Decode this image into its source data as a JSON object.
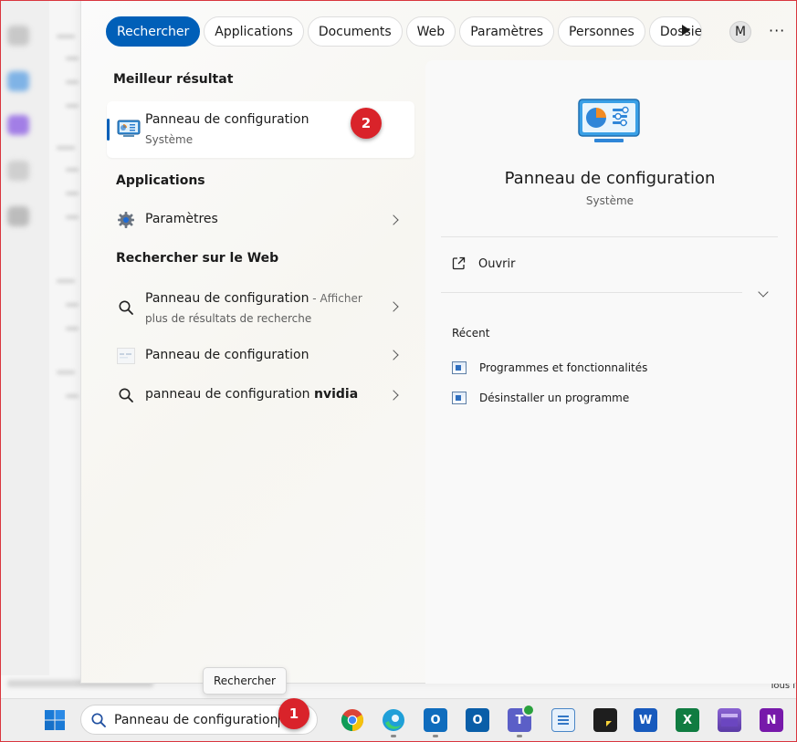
{
  "tabs": [
    {
      "label": "Rechercher",
      "active": true
    },
    {
      "label": "Applications"
    },
    {
      "label": "Documents"
    },
    {
      "label": "Web"
    },
    {
      "label": "Paramètres"
    },
    {
      "label": "Personnes"
    },
    {
      "label": "Dossiers"
    }
  ],
  "user_initial": "M",
  "more_label": "···",
  "best_result": {
    "heading": "Meilleur résultat",
    "title": "Panneau de configuration",
    "subtitle": "Système",
    "badge": "2"
  },
  "applications": {
    "heading": "Applications",
    "items": [
      {
        "label": "Paramètres"
      }
    ]
  },
  "web": {
    "heading": "Rechercher sur le Web",
    "items": [
      {
        "label": "Panneau de configuration",
        "hint": " - Afficher",
        "sub": "plus de résultats de recherche"
      },
      {
        "label": "Panneau de configuration"
      },
      {
        "label": "panneau de configuration ",
        "bold": "nvidia"
      }
    ]
  },
  "preview": {
    "title": "Panneau de configuration",
    "subtitle": "Système",
    "open_label": "Ouvrir",
    "recent_heading": "Récent",
    "recent_items": [
      {
        "label": "Programmes et fonctionnalités"
      },
      {
        "label": "Désinstaller un programme"
      }
    ]
  },
  "tooltip": "Rechercher",
  "taskbar": {
    "search_value": "Panneau de configuration",
    "badge": "1",
    "bg_label": "Tous l"
  },
  "colors": {
    "accent": "#005fb8",
    "badge": "#d9232a"
  }
}
